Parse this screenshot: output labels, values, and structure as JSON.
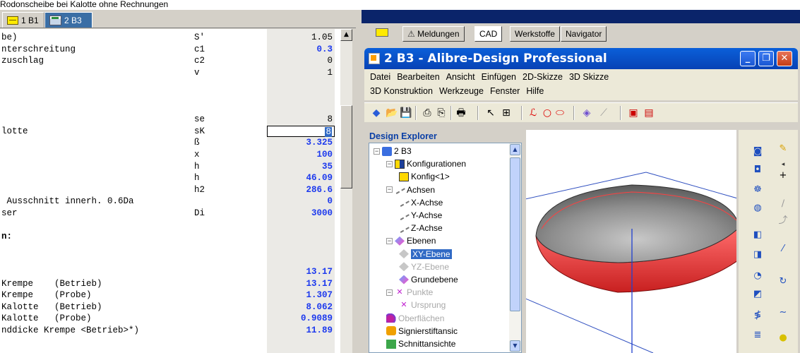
{
  "caption": "Rodonscheibe bei Kalotte ohne Rechnungen",
  "left_app": {
    "tabs": [
      {
        "label": "1 B1",
        "icon": "yellow-sheet-icon",
        "active": false
      },
      {
        "label": "2 B3",
        "icon": "spreadsheet-icon",
        "active": true
      }
    ],
    "rows": [
      {
        "name": "be)",
        "symbol": "S'",
        "value": "1.05",
        "blue": false
      },
      {
        "name": "nterschreitung",
        "symbol": "c1",
        "value": "0.3",
        "blue": true
      },
      {
        "name": "zuschlag",
        "symbol": "c2",
        "value": "0",
        "blue": false
      },
      {
        "name": "",
        "symbol": "v",
        "value": "1",
        "blue": false
      },
      {
        "name": "",
        "symbol": "",
        "value": "",
        "blue": false
      },
      {
        "name": "",
        "symbol": "",
        "value": "",
        "blue": false
      },
      {
        "name": "",
        "symbol": "",
        "value": "",
        "blue": false
      },
      {
        "name": "",
        "symbol": "se",
        "value": "8",
        "blue": false
      },
      {
        "name": "lotte",
        "symbol": "sK",
        "value": "8",
        "blue": false,
        "selected": true
      },
      {
        "name": "",
        "symbol": "ß",
        "value": "3.325",
        "blue": true
      },
      {
        "name": "",
        "symbol": "x",
        "value": "100",
        "blue": true
      },
      {
        "name": "",
        "symbol": "h",
        "value": "35",
        "blue": true
      },
      {
        "name": "",
        "symbol": "h",
        "value": "46.09",
        "blue": true
      },
      {
        "name": "",
        "symbol": "h2",
        "value": "286.6",
        "blue": true
      },
      {
        "name": " Ausschnitt innerh. 0.6Da",
        "symbol": "",
        "value": "0",
        "blue": true
      },
      {
        "name": "ser",
        "symbol": "Di",
        "value": "3000",
        "blue": true
      },
      {
        "name": "",
        "symbol": "",
        "value": "",
        "blue": false
      },
      {
        "name": "n:",
        "symbol": "",
        "value": "",
        "blue": false,
        "bold": true
      },
      {
        "name": "",
        "symbol": "",
        "value": "",
        "blue": false
      },
      {
        "name": "",
        "symbol": "",
        "value": "",
        "blue": false
      },
      {
        "name": "",
        "symbol": "",
        "value": "13.17",
        "blue": true
      },
      {
        "name": "Krempe    (Betrieb)",
        "symbol": "",
        "value": "13.17",
        "blue": true
      },
      {
        "name": "Krempe    (Probe)",
        "symbol": "",
        "value": "1.307",
        "blue": true
      },
      {
        "name": "Kalotte   (Betrieb)",
        "symbol": "",
        "value": "8.062",
        "blue": true
      },
      {
        "name": "Kalotte   (Probe)",
        "symbol": "",
        "value": "0.9089",
        "blue": true
      },
      {
        "name": "nddicke Krempe <Betrieb>*)",
        "symbol": "",
        "value": "11.89",
        "blue": true
      }
    ]
  },
  "right_app": {
    "tabs": [
      "Meldungen",
      "CAD",
      "Werkstoffe",
      "Navigator"
    ],
    "active_tab": "CAD",
    "window_title": "2 B3 - Alibre-Design Professional",
    "menu_row1": [
      "Datei",
      "Bearbeiten",
      "Ansicht",
      "Einfügen",
      "2D-Skizze",
      "3D Skizze"
    ],
    "menu_row2": [
      "3D Konstruktion",
      "Werkzeuge",
      "Fenster",
      "Hilfe"
    ],
    "explorer_title": "Design Explorer",
    "tree": [
      {
        "label": "2 B3",
        "level": 0,
        "icon": "part-icon",
        "exp": "−"
      },
      {
        "label": "Konfigurationen",
        "level": 1,
        "icon": "config-icon",
        "exp": "−"
      },
      {
        "label": "Konfig<1>",
        "level": 2,
        "icon": "config-item-icon"
      },
      {
        "label": "Achsen",
        "level": 1,
        "icon": "axis-icon",
        "exp": "−"
      },
      {
        "label": "X-Achse",
        "level": 2,
        "icon": "axis-icon"
      },
      {
        "label": "Y-Achse",
        "level": 2,
        "icon": "axis-icon"
      },
      {
        "label": "Z-Achse",
        "level": 2,
        "icon": "axis-icon"
      },
      {
        "label": "Ebenen",
        "level": 1,
        "icon": "plane-icon",
        "exp": "−"
      },
      {
        "label": "XY-Ebene",
        "level": 2,
        "icon": "plane-gray-icon",
        "selected": true
      },
      {
        "label": "YZ-Ebene",
        "level": 2,
        "icon": "plane-gray-icon",
        "dim": true
      },
      {
        "label": "Grundebene",
        "level": 2,
        "icon": "plane-icon"
      },
      {
        "label": "Punkte",
        "level": 1,
        "icon": "point-icon",
        "exp": "−",
        "dim": true
      },
      {
        "label": "Ursprung",
        "level": 2,
        "icon": "point-icon",
        "dim": true
      },
      {
        "label": "Oberflächen",
        "level": 1,
        "icon": "surface-icon",
        "dim": true
      },
      {
        "label": "Signierstiftansic",
        "level": 1,
        "icon": "signature-icon"
      },
      {
        "label": "Schnittansichte",
        "level": 1,
        "icon": "section-icon"
      }
    ]
  }
}
